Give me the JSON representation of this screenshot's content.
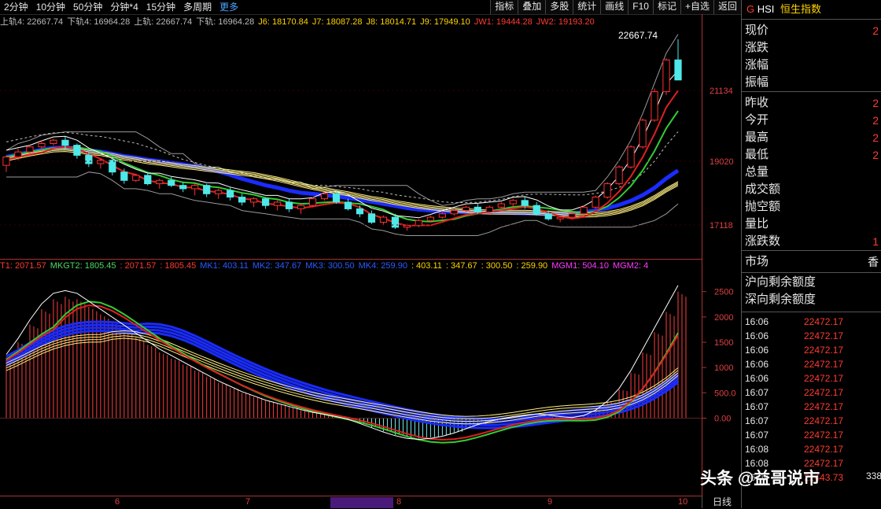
{
  "toolbar": {
    "periods": [
      "2分钟",
      "10分钟",
      "50分钟",
      "分钟*4",
      "15分钟",
      "多周期"
    ],
    "more": "更多",
    "buttons": [
      "指标",
      "叠加",
      "多股",
      "统计",
      "画线",
      "F10",
      "标记",
      "+自选",
      "返回"
    ]
  },
  "indicators_main": [
    {
      "text": "上轨4: 22667.74",
      "color": "#bbbbbb"
    },
    {
      "text": "下轨4: 16964.28",
      "color": "#bbbbbb"
    },
    {
      "text": "上轨: 22667.74",
      "color": "#bbbbbb"
    },
    {
      "text": "下轨: 16964.28",
      "color": "#bbbbbb"
    },
    {
      "text": "J6: 18170.84",
      "color": "#ffd400"
    },
    {
      "text": "J7: 18087.28",
      "color": "#ffd400"
    },
    {
      "text": "J8: 18014.71",
      "color": "#ffd400"
    },
    {
      "text": "J9: 17949.10",
      "color": "#ffd400"
    },
    {
      "text": "JW1: 19444.28",
      "color": "#ff3b30"
    },
    {
      "text": "JW2: 19193.20",
      "color": "#ff3b30"
    }
  ],
  "indicators_sub": [
    {
      "text": "T1: 2071.57",
      "color": "#ff3b30"
    },
    {
      "text": "MKGT2: 1805.45",
      "color": "#4cd964"
    },
    {
      "text": ": 2071.57",
      "color": "#ff3b30"
    },
    {
      "text": ": 1805.45",
      "color": "#ff3b30"
    },
    {
      "text": "MK1: 403.11",
      "color": "#2a5cff"
    },
    {
      "text": "MK2: 347.67",
      "color": "#2a5cff"
    },
    {
      "text": "MK3: 300.50",
      "color": "#2a5cff"
    },
    {
      "text": "MK4: 259.90",
      "color": "#2a5cff"
    },
    {
      "text": ": 403.11",
      "color": "#ffd400"
    },
    {
      "text": ": 347.67",
      "color": "#ffd400"
    },
    {
      "text": ": 300.50",
      "color": "#ffd400"
    },
    {
      "text": ": 259.90",
      "color": "#ffd400"
    },
    {
      "text": "MGM1: 504.10",
      "color": "#ff3bff"
    },
    {
      "text": "MGM2: 4",
      "color": "#ff3bff"
    }
  ],
  "main_axis": [
    "21134",
    "19020",
    "17118"
  ],
  "sub_axis": [
    "2500",
    "2000",
    "1500",
    "1000",
    "500.0",
    "0.00"
  ],
  "high_label": "22667.74",
  "date_labels": [
    "6",
    "7",
    "8",
    "9",
    "10"
  ],
  "day_label": "日线",
  "right_panel": {
    "code": "G",
    "symbol": "HSI",
    "name": "恒生指数",
    "quote_rows": [
      {
        "label": "现价",
        "value": "2"
      },
      {
        "label": "涨跌",
        "value": ""
      },
      {
        "label": "涨幅",
        "value": ""
      },
      {
        "label": "振幅",
        "value": ""
      },
      {
        "label": "昨收",
        "value": "2"
      },
      {
        "label": "今开",
        "value": "2"
      },
      {
        "label": "最高",
        "value": "2"
      },
      {
        "label": "最低",
        "value": "2"
      },
      {
        "label": "总量",
        "value": ""
      },
      {
        "label": "成交额",
        "value": ""
      },
      {
        "label": "抛空额",
        "value": ""
      },
      {
        "label": "量比",
        "value": ""
      },
      {
        "label": "涨跌数",
        "value": "1"
      }
    ],
    "market_label": "市场",
    "market_value": "香",
    "quota_rows": [
      "沪向剩余额度",
      "深向剩余额度"
    ],
    "trades": [
      {
        "time": "16:06",
        "price": "22472.17"
      },
      {
        "time": "16:06",
        "price": "22472.17"
      },
      {
        "time": "16:06",
        "price": "22472.17"
      },
      {
        "time": "16:06",
        "price": "22472.17"
      },
      {
        "time": "16:06",
        "price": "22472.17"
      },
      {
        "time": "16:07",
        "price": "22472.17"
      },
      {
        "time": "16:07",
        "price": "22472.17"
      },
      {
        "time": "16:07",
        "price": "22472.17"
      },
      {
        "time": "16:07",
        "price": "22472.17"
      },
      {
        "time": "16:08",
        "price": "22472.17"
      },
      {
        "time": "16:08",
        "price": "22472.17"
      },
      {
        "time": "16:09",
        "price": "22443.73"
      }
    ],
    "partial_value": "338"
  },
  "watermark": "头条 @益哥说市",
  "chart_data": {
    "type": "candlestick",
    "main_ylim": [
      16200,
      22900
    ],
    "sub_ylim": [
      -1500,
      2900
    ],
    "candles": [
      [
        18900,
        19200,
        18700,
        19150
      ],
      [
        19150,
        19400,
        19050,
        19300
      ],
      [
        19300,
        19500,
        19200,
        19450
      ],
      [
        19450,
        19650,
        19350,
        19550
      ],
      [
        19550,
        19700,
        19500,
        19650
      ],
      [
        19650,
        19750,
        19400,
        19500
      ],
      [
        19500,
        19550,
        19100,
        19200
      ],
      [
        19200,
        19300,
        18850,
        18950
      ],
      [
        18950,
        19100,
        18800,
        19050
      ],
      [
        19050,
        19100,
        18600,
        18700
      ],
      [
        18700,
        18800,
        18350,
        18450
      ],
      [
        18450,
        18650,
        18400,
        18600
      ],
      [
        18600,
        18700,
        18300,
        18350
      ],
      [
        18350,
        18500,
        18200,
        18450
      ],
      [
        18450,
        18550,
        18250,
        18300
      ],
      [
        18300,
        18400,
        18100,
        18200
      ],
      [
        18200,
        18350,
        18000,
        18300
      ],
      [
        18300,
        18350,
        17950,
        18050
      ],
      [
        18050,
        18200,
        17900,
        18150
      ],
      [
        18150,
        18250,
        17850,
        17950
      ],
      [
        17950,
        18050,
        17700,
        17800
      ],
      [
        17800,
        17950,
        17650,
        17900
      ],
      [
        17900,
        17950,
        17600,
        17700
      ],
      [
        17700,
        17850,
        17550,
        17800
      ],
      [
        17800,
        17900,
        17500,
        17600
      ],
      [
        17600,
        17750,
        17450,
        17700
      ],
      [
        17700,
        17950,
        17650,
        17900
      ],
      [
        17900,
        18100,
        17850,
        18050
      ],
      [
        18050,
        18150,
        17750,
        17800
      ],
      [
        17800,
        17900,
        17550,
        17600
      ],
      [
        17600,
        17700,
        17350,
        17450
      ],
      [
        17450,
        17550,
        17150,
        17200
      ],
      [
        17200,
        17400,
        17100,
        17350
      ],
      [
        17350,
        17450,
        17000,
        17050
      ],
      [
        17050,
        17150,
        16950,
        17100
      ],
      [
        17100,
        17300,
        17050,
        17250
      ],
      [
        17250,
        17400,
        17200,
        17350
      ],
      [
        17350,
        17500,
        17300,
        17450
      ],
      [
        17450,
        17600,
        17400,
        17550
      ],
      [
        17550,
        17700,
        17500,
        17650
      ],
      [
        17650,
        17750,
        17450,
        17500
      ],
      [
        17500,
        17700,
        17450,
        17650
      ],
      [
        17650,
        17800,
        17550,
        17750
      ],
      [
        17750,
        17900,
        17650,
        17850
      ],
      [
        17850,
        17950,
        17600,
        17700
      ],
      [
        17700,
        17800,
        17400,
        17450
      ],
      [
        17450,
        17550,
        17250,
        17300
      ],
      [
        17300,
        17400,
        17200,
        17350
      ],
      [
        17350,
        17500,
        17300,
        17450
      ],
      [
        17450,
        17700,
        17400,
        17650
      ],
      [
        17650,
        18000,
        17600,
        17950
      ],
      [
        17950,
        18400,
        17900,
        18350
      ],
      [
        18350,
        18900,
        18300,
        18850
      ],
      [
        18850,
        19500,
        18800,
        19450
      ],
      [
        19450,
        20300,
        19400,
        20250
      ],
      [
        20250,
        21200,
        20200,
        21100
      ],
      [
        21100,
        22100,
        21000,
        22050
      ],
      [
        22050,
        22667,
        21800,
        21450
      ]
    ],
    "macd_hist": [
      1200,
      1500,
      1850,
      2150,
      2350,
      2400,
      2350,
      2200,
      2050,
      1900,
      1750,
      1600,
      1450,
      1300,
      1180,
      1060,
      940,
      820,
      700,
      600,
      500,
      420,
      340,
      280,
      220,
      160,
      110,
      70,
      30,
      -20,
      -100,
      -180,
      -260,
      -330,
      -380,
      -400,
      -380,
      -340,
      -280,
      -200,
      -120,
      -60,
      -10,
      30,
      60,
      80,
      60,
      30,
      10,
      50,
      150,
      320,
      560,
      900,
      1300,
      1700,
      2100,
      2500
    ]
  }
}
